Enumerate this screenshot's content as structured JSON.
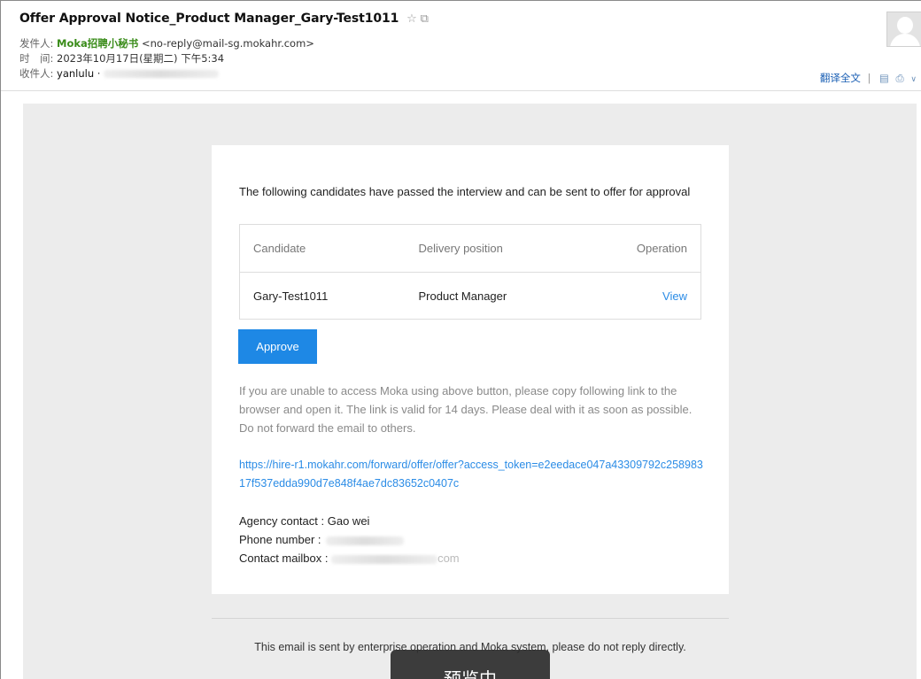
{
  "header": {
    "subject": "Offer Approval Notice_Product Manager_Gary-Test1011",
    "star_icon": "☆",
    "popout_icon": "⧉",
    "from_label": "发件人:",
    "from_name": "Moka招聘小秘书",
    "from_email": "<no-reply@mail-sg.mokahr.com>",
    "time_label": "时　间:",
    "time_value": "2023年10月17日(星期二) 下午5:34",
    "to_label": "收件人:",
    "to_value": "yanlulu",
    "to_sep": "·",
    "translate_label": "翻译全文",
    "tool_sep": "|"
  },
  "mail": {
    "intro": "The following candidates have passed the interview and can be sent to offer for approval",
    "table": {
      "headers": [
        "Candidate",
        "Delivery position",
        "Operation"
      ],
      "rows": [
        {
          "candidate": "Gary-Test1011",
          "position": "Product Manager",
          "operation": "View"
        }
      ]
    },
    "approve_label": "Approve",
    "note": "If you are unable to access Moka using above button, please copy following link to the browser and open it. The link is valid for 14 days. Please deal with it as soon as possible. Do not forward the email to others.",
    "link": "https://hire-r1.mokahr.com/forward/offer/offer?access_token=e2eedace047a43309792c25898317f537edda990d7e848f4ae7dc83652c0407c",
    "agency_label": "Agency contact :",
    "agency_value": "Gao wei",
    "phone_label": "Phone number :",
    "mailbox_label": "Contact mailbox :",
    "mailbox_value_visible": "com",
    "footer": "This email is sent by enterprise operation and Moka system, please do not reply directly."
  },
  "toast": {
    "text": "预览中"
  },
  "colors": {
    "accent": "#1e88e5",
    "link": "#2b8ce6",
    "sender": "#3a8c1a",
    "mail_bg": "#ececec"
  }
}
